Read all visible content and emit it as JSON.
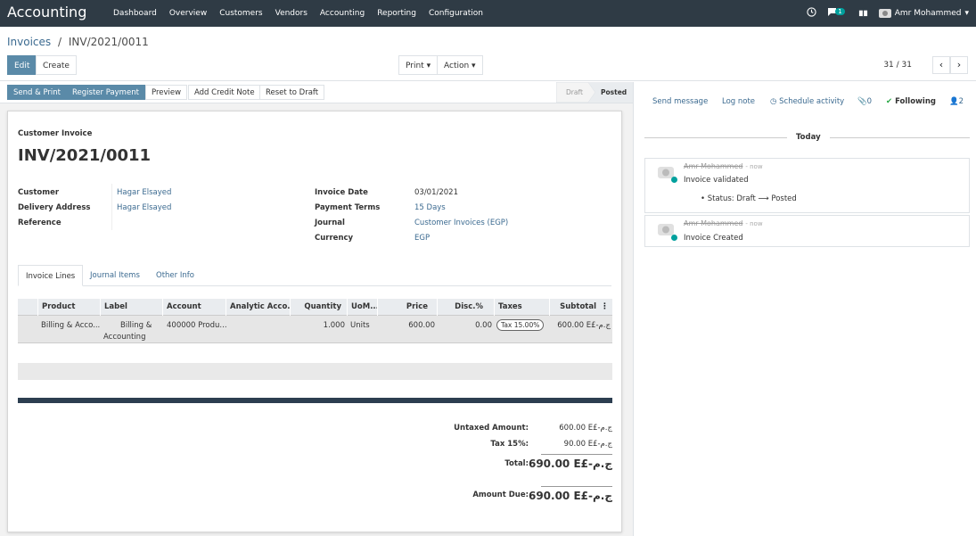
{
  "topbar": {
    "brand": "Accounting",
    "menu": [
      "Dashboard",
      "Overview",
      "Customers",
      "Vendors",
      "Accounting",
      "Reporting",
      "Configuration"
    ],
    "chat_badge": "1",
    "user": "Amr Mohammed"
  },
  "breadcrumb": {
    "parent": "Invoices",
    "separator": "/",
    "current": "INV/2021/0011"
  },
  "actions": {
    "edit": "Edit",
    "create": "Create",
    "print": "Print",
    "action": "Action"
  },
  "pager": {
    "value": "31 / 31"
  },
  "statusbar": {
    "buttons": [
      "Send & Print",
      "Register Payment",
      "Preview",
      "Add Credit Note",
      "Reset to Draft"
    ],
    "stages": [
      "Draft",
      "Posted"
    ],
    "active_stage": "Posted"
  },
  "invoice": {
    "type": "Customer Invoice",
    "number": "INV/2021/0011",
    "left_fields": [
      {
        "label": "Customer",
        "value": "Hagar Elsayed"
      },
      {
        "label": "Delivery Address",
        "value": "Hagar Elsayed"
      },
      {
        "label": "Reference",
        "value": ""
      }
    ],
    "right_fields": [
      {
        "label": "Invoice Date",
        "value": "03/01/2021"
      },
      {
        "label": "Payment Terms",
        "value": "15 Days"
      },
      {
        "label": "Journal",
        "value": "Customer Invoices (EGP)"
      },
      {
        "label": "Currency",
        "value": "EGP"
      }
    ],
    "tabs": [
      "Invoice Lines",
      "Journal Items",
      "Other Info"
    ],
    "columns": [
      "Product",
      "Label",
      "Account",
      "Analytic Acco...",
      "Quantity",
      "UoM...",
      "Price",
      "Disc.%",
      "Taxes",
      "Subtotal"
    ],
    "lines": [
      {
        "product": "Billing & Acco...",
        "label_line1": "Billing &",
        "label_line2": "Accounting",
        "account": "400000 Produ...",
        "analytic": "",
        "quantity": "1.000",
        "uom": "Units",
        "price": "600.00",
        "disc": "0.00",
        "tax": "Tax 15.00%",
        "subtotal": "600.00 E£-ج.م"
      }
    ],
    "totals": [
      {
        "label": "Untaxed Amount:",
        "value": "600.00 E£-ج.م"
      },
      {
        "label": "Tax 15%:",
        "value": "90.00 E£-ج.م"
      },
      {
        "label": "Total:",
        "value": "690.00 E£-ج.م"
      },
      {
        "label": "Amount Due:",
        "value": "690.00 E£-ج.م"
      }
    ]
  },
  "chatter": {
    "send_message": "Send message",
    "log_note": "Log note",
    "schedule_activity": "Schedule activity",
    "attachments": "0",
    "following": "Following",
    "followers": "2",
    "day": "Today",
    "messages": [
      {
        "author": "Amr Mohammed",
        "time": "now",
        "text": "Invoice validated",
        "tracking": "Status: Draft ⟶ Posted"
      },
      {
        "author": "Amr Mohammed",
        "time": "now",
        "text": "Invoice Created",
        "tracking": ""
      }
    ]
  },
  "colors": {
    "navbar": "#2f3b45",
    "primary": "#5a8aa8",
    "link": "#3b6a90",
    "teal": "#00a09d"
  }
}
